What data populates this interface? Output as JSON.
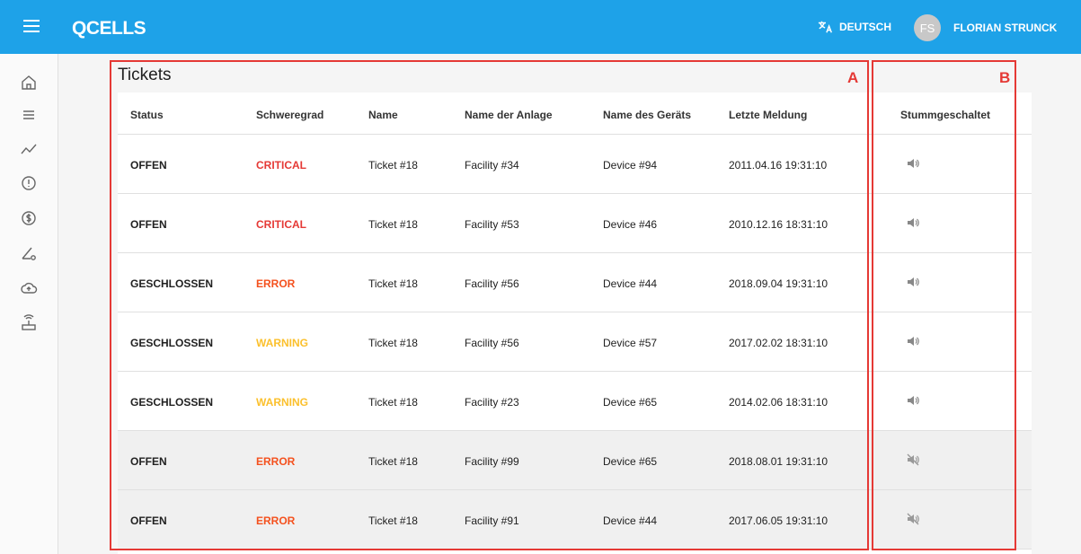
{
  "app": {
    "logo": "QCELLS",
    "language": "DEUTSCH",
    "user_initials": "FS",
    "user_name": "FLORIAN STRUNCK"
  },
  "page": {
    "title": "Tickets"
  },
  "table": {
    "headers": {
      "status": "Status",
      "severity": "Schweregrad",
      "name": "Name",
      "facility": "Name der Anlage",
      "device": "Name des Geräts",
      "last": "Letzte Meldung",
      "muted": "Stummgeschaltet"
    },
    "rows": [
      {
        "status": "OFFEN",
        "severity": "CRITICAL",
        "name": "Ticket #18",
        "facility": "Facility #34",
        "device": "Device #94",
        "last": "2011.04.16 19:31:10",
        "muted": false
      },
      {
        "status": "OFFEN",
        "severity": "CRITICAL",
        "name": "Ticket #18",
        "facility": "Facility #53",
        "device": "Device #46",
        "last": "2010.12.16 18:31:10",
        "muted": false
      },
      {
        "status": "GESCHLOSSEN",
        "severity": "ERROR",
        "name": "Ticket #18",
        "facility": "Facility #56",
        "device": "Device #44",
        "last": "2018.09.04 19:31:10",
        "muted": false
      },
      {
        "status": "GESCHLOSSEN",
        "severity": "WARNING",
        "name": "Ticket #18",
        "facility": "Facility #56",
        "device": "Device #57",
        "last": "2017.02.02 18:31:10",
        "muted": false
      },
      {
        "status": "GESCHLOSSEN",
        "severity": "WARNING",
        "name": "Ticket #18",
        "facility": "Facility #23",
        "device": "Device #65",
        "last": "2014.02.06 18:31:10",
        "muted": false
      },
      {
        "status": "OFFEN",
        "severity": "ERROR",
        "name": "Ticket #18",
        "facility": "Facility #99",
        "device": "Device #65",
        "last": "2018.08.01 19:31:10",
        "muted": true
      },
      {
        "status": "OFFEN",
        "severity": "ERROR",
        "name": "Ticket #18",
        "facility": "Facility #91",
        "device": "Device #44",
        "last": "2017.06.05 19:31:10",
        "muted": true
      }
    ]
  },
  "annotations": {
    "a": "A",
    "b": "B"
  },
  "colors": {
    "topbar": "#1ea2e8",
    "critical": "#e53935",
    "error": "#f4511e",
    "warning": "#fbc02d",
    "annotation": "#e53935"
  },
  "icons": {
    "menu": "menu-icon",
    "language": "translate-icon",
    "nav": [
      "home-icon",
      "list-icon",
      "trending-icon",
      "alert-icon",
      "dollar-icon",
      "angle-settings-icon",
      "cloud-upload-icon",
      "router-icon"
    ],
    "sound_on": "volume-on-icon",
    "sound_off": "volume-off-icon"
  }
}
